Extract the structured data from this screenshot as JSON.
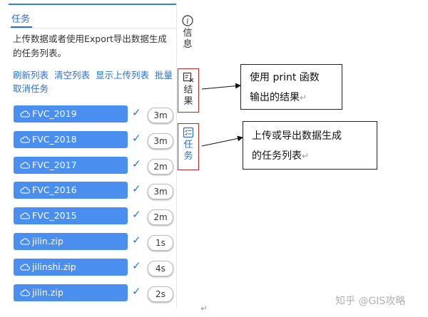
{
  "tab": {
    "title": "任务"
  },
  "description": "上传数据或者使用Export导出数据生成的任务列表。",
  "actions": [
    "刷新列表",
    "清空列表",
    "显示上传列表",
    "批量取消任务"
  ],
  "tasks": [
    {
      "name": "FVC_2019",
      "duration": "3m"
    },
    {
      "name": "FVC_2018",
      "duration": "3m"
    },
    {
      "name": "FVC_2017",
      "duration": "2m"
    },
    {
      "name": "FVC_2016",
      "duration": "3m"
    },
    {
      "name": "FVC_2015",
      "duration": "2m"
    },
    {
      "name": "jilin.zip",
      "duration": "1s"
    },
    {
      "name": "jilinshi.zip",
      "duration": "4s"
    },
    {
      "name": "jilin.zip",
      "duration": "2s"
    }
  ],
  "sidebar": {
    "info": "信息",
    "result": "结果",
    "task": "任务"
  },
  "callouts": {
    "result": {
      "line1": "使用 print 函数",
      "line2": "输出的结果",
      "mark": "↵"
    },
    "task": {
      "line1": "上传或导出数据生成",
      "line2": "的任务列表",
      "mark": "↵"
    }
  },
  "bottom_mark": "↵",
  "watermark": "知乎 @GIS攻略",
  "colors": {
    "accent": "#2a6fcf",
    "task_bg": "#4a8ff0",
    "highlight_border": "#b52a22"
  }
}
